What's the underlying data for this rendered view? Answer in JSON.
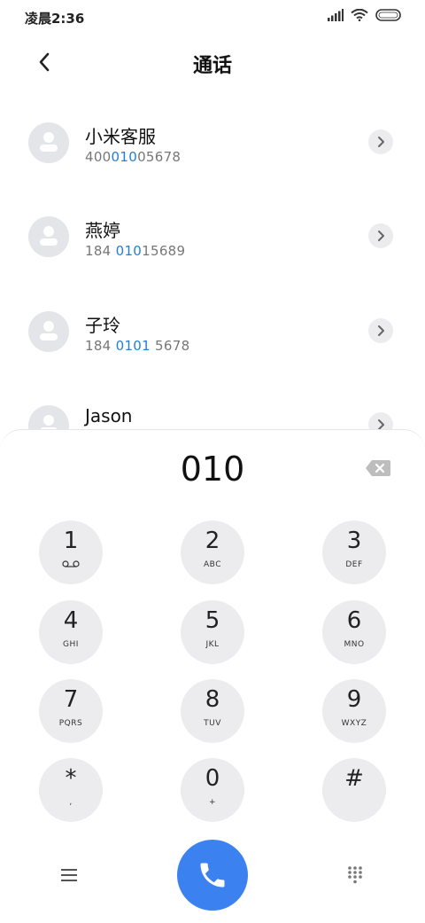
{
  "status_bar": {
    "time": "凌晨2:36"
  },
  "header": {
    "title": "通话"
  },
  "contacts": [
    {
      "name": "小米客服",
      "number_pre": "400",
      "number_hl": "010",
      "number_post": "05678"
    },
    {
      "name": "燕婷",
      "number_pre": "184 ",
      "number_hl": "010",
      "number_post": "15689"
    },
    {
      "name": "子玲",
      "number_pre": "184 ",
      "number_hl": "0101",
      "number_post": " 5678"
    },
    {
      "name": "Jason",
      "number_pre": "",
      "number_hl": "",
      "number_post": ""
    }
  ],
  "dialer": {
    "input": "010"
  },
  "keys": [
    {
      "digit": "1",
      "letters": ""
    },
    {
      "digit": "2",
      "letters": "ABC"
    },
    {
      "digit": "3",
      "letters": "DEF"
    },
    {
      "digit": "4",
      "letters": "GHI"
    },
    {
      "digit": "5",
      "letters": "JKL"
    },
    {
      "digit": "6",
      "letters": "MNO"
    },
    {
      "digit": "7",
      "letters": "PQRS"
    },
    {
      "digit": "8",
      "letters": "TUV"
    },
    {
      "digit": "9",
      "letters": "WXYZ"
    },
    {
      "digit": "*",
      "letters": ","
    },
    {
      "digit": "0",
      "letters": "+"
    },
    {
      "digit": "#",
      "letters": ""
    }
  ],
  "colors": {
    "accent": "#3b82f0",
    "highlight": "#1f7fd9",
    "key_bg": "#ececee",
    "avatar_bg": "#e4e5e8"
  },
  "icons": {
    "back": "chevron-left-icon",
    "row_action": "chevron-right-icon",
    "backspace": "backspace-icon",
    "menu": "menu-icon",
    "call": "phone-icon",
    "keypad": "dialpad-icon",
    "voicemail": "voicemail-icon"
  }
}
